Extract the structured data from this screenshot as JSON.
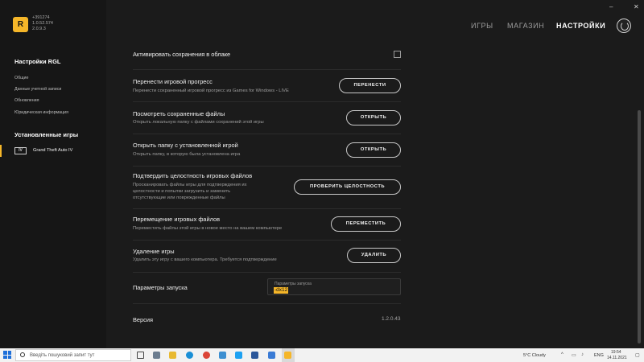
{
  "app": {
    "version_lines": [
      "+391274",
      "1.0.52.574",
      "2.0.9.3"
    ],
    "logo_text": "R"
  },
  "window_controls": {
    "minimize": "–",
    "close": "✕"
  },
  "nav": {
    "games": "ИГРЫ",
    "store": "МАГАЗИН",
    "settings": "НАСТРОЙКИ"
  },
  "sidebar": {
    "rgl_section": "Настройки RGL",
    "rgl_items": [
      "Общие",
      "Данные учетной записи",
      "Обновления",
      "Юридическая информация"
    ],
    "installed_section": "Установленные игры",
    "game_icon_text": "IV",
    "game": "Grand Theft Auto IV"
  },
  "settings": {
    "cloud_saves": {
      "title": "Активировать сохранения в облаке"
    },
    "transfer": {
      "title": "Перенести игровой прогресс",
      "desc": "Перенести сохраненный игровой прогресс из Games for Windows - LIVE",
      "button": "ПЕРЕНЕСТИ"
    },
    "view_saves": {
      "title": "Посмотреть сохраненные файлы",
      "desc": "Открыть локальную папку с файлами сохранений этой игры",
      "button": "ОТКРЫТЬ"
    },
    "open_folder": {
      "title": "Открыть папку с установленной игрой",
      "desc": "Открыть папку, в которую была установлена игра",
      "button": "ОТКРЫТЬ"
    },
    "verify": {
      "title": "Подтвердить целостность игровых файлов",
      "desc_lines": [
        "Просканировать файлы игры для подтверждения их",
        "целостности и попытки загрузить и заменить",
        "отсутствующие или поврежденные файлы"
      ],
      "button": "ПРОВЕРИТЬ ЦЕЛОСТНОСТЬ"
    },
    "move": {
      "title": "Перемещение игровых файлов",
      "desc": "Переместить файлы этой игры в новое место на вашем компьютере",
      "button": "ПЕРЕМЕСТИТЬ"
    },
    "uninstall": {
      "title": "Удаление игры",
      "desc": "Удалить эту игру с вашего компьютера. Требуется подтверждение",
      "button": "УДАЛИТЬ"
    },
    "launch_params": {
      "title": "Параметры запуска",
      "field_label": "Параметры запуска",
      "field_value": "-dx12"
    },
    "version": {
      "title": "Версия",
      "value": "1.2.0.43"
    }
  },
  "taskbar": {
    "search_placeholder": "Введіть пошуковий запит тут",
    "weather": "5°C  Cloudy",
    "lang": "ENG",
    "time": "19:54",
    "date": "14.11.2021"
  },
  "colors": {
    "accent": "#f5b629",
    "background": "#1b1b1b",
    "sidebar": "#161616"
  }
}
